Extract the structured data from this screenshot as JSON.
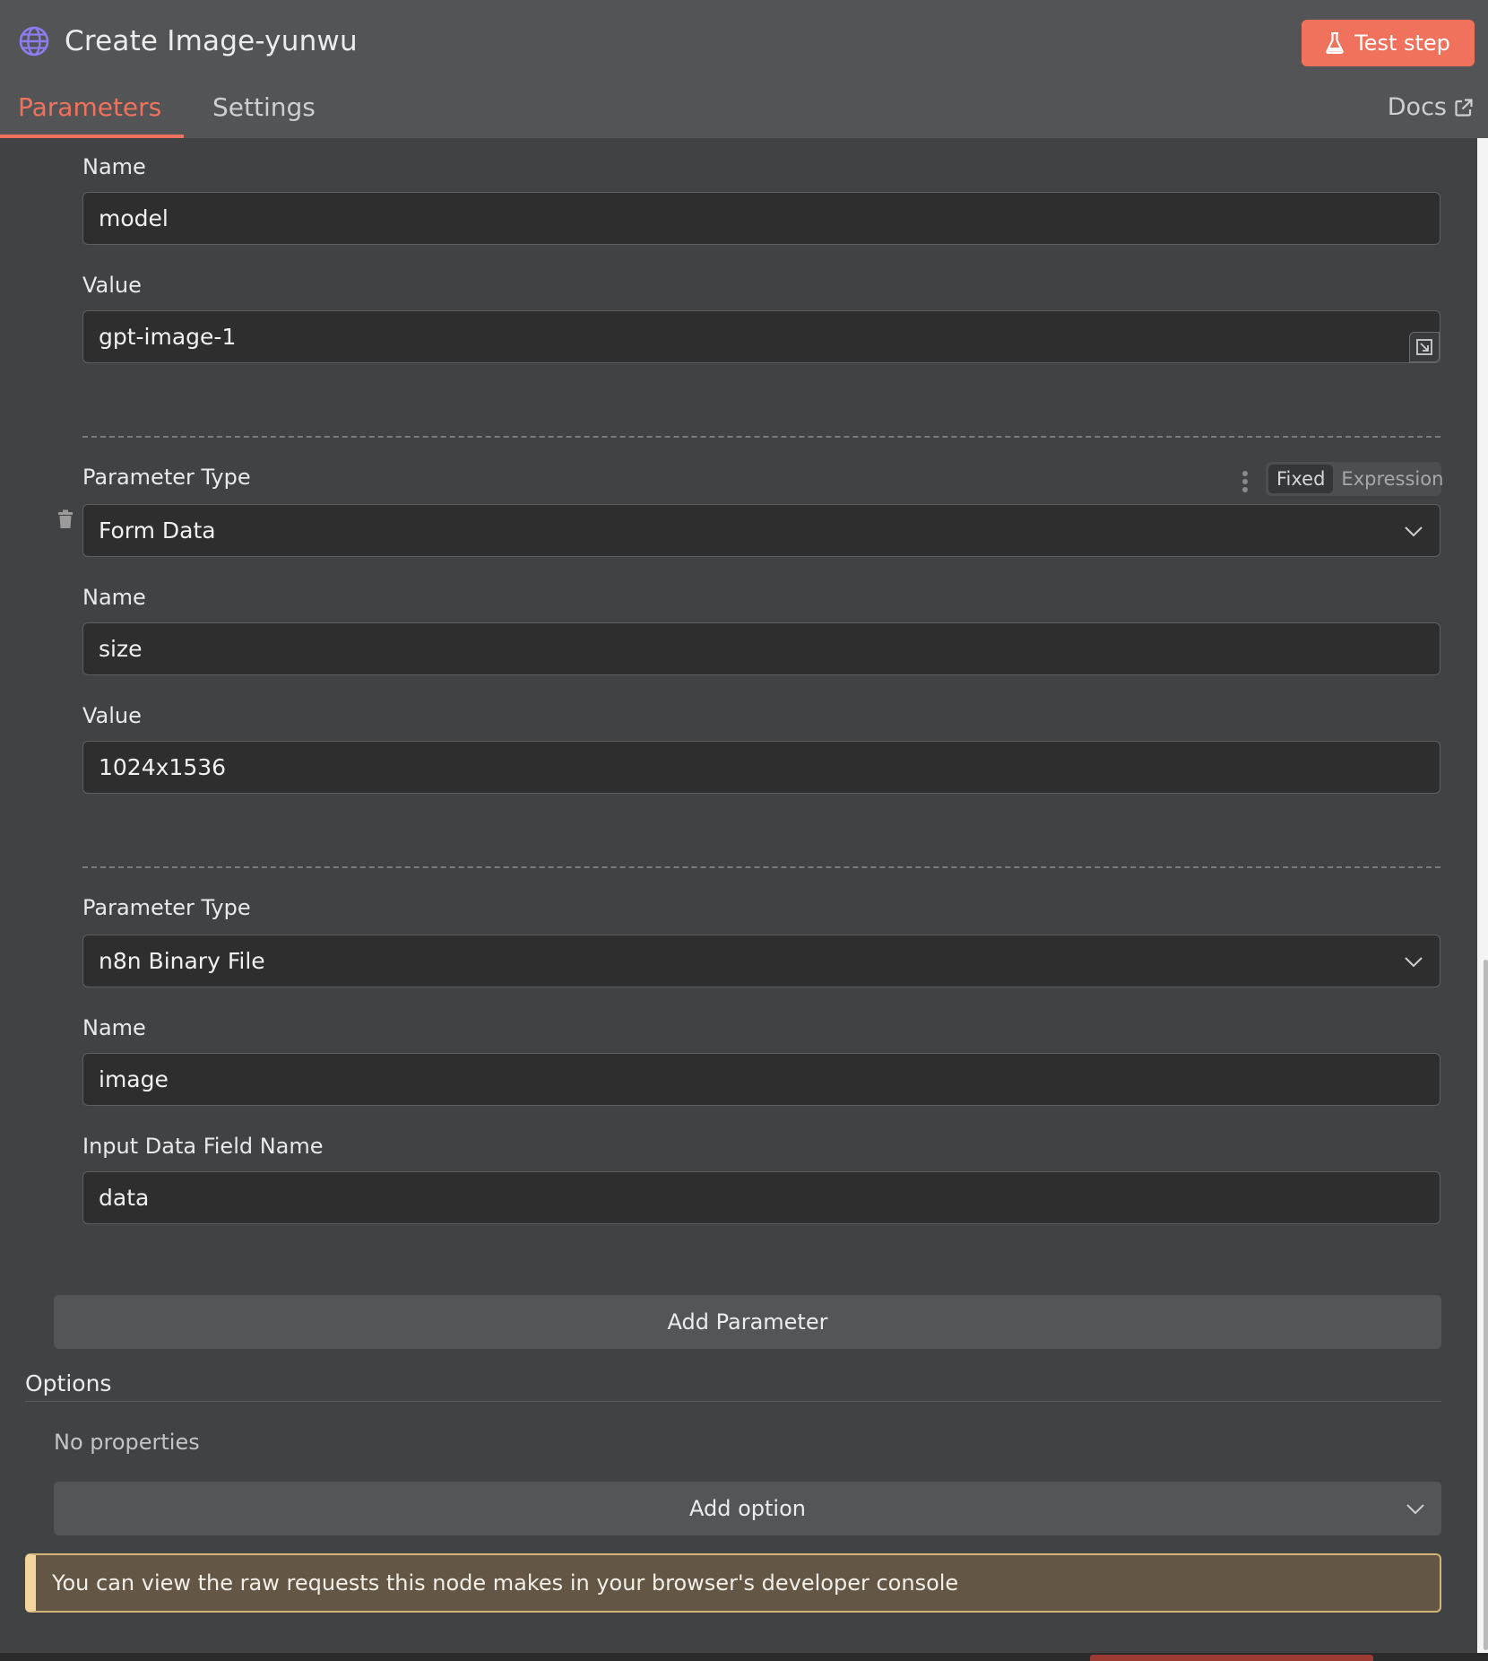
{
  "header": {
    "title": "Create Image-yunwu",
    "test_step_label": "Test step",
    "docs_label": "Docs"
  },
  "tabs": [
    {
      "label": "Parameters",
      "active": true
    },
    {
      "label": "Settings",
      "active": false
    }
  ],
  "params": {
    "p1": {
      "name_label": "Name",
      "name_value": "model",
      "value_label": "Value",
      "value_value": "gpt-image-1"
    },
    "p2": {
      "type_label": "Parameter Type",
      "type_value": "Form Data",
      "name_label": "Name",
      "name_value": "size",
      "value_label": "Value",
      "value_value": "1024x1536"
    },
    "p3": {
      "type_label": "Parameter Type",
      "type_value": "n8n Binary File",
      "name_label": "Name",
      "name_value": "image",
      "field_label": "Input Data Field Name",
      "field_value": "data"
    }
  },
  "toggle": {
    "fixed": "Fixed",
    "expression": "Expression"
  },
  "add_parameter_label": "Add Parameter",
  "options": {
    "title": "Options",
    "empty_text": "No properties",
    "add_option_label": "Add option"
  },
  "notice": "You can view the raw requests this node makes in your browser's developer console",
  "colors": {
    "accent": "#f0715c",
    "background": "#414244",
    "header": "#535456",
    "input": "#2e2e2f",
    "notice_bg": "#635645",
    "notice_border": "#f1d59c"
  },
  "icons": [
    "globe-icon",
    "flask-icon",
    "external-link-icon",
    "expand-icon",
    "trash-icon",
    "kebab-icon",
    "chevron-down-icon"
  ]
}
